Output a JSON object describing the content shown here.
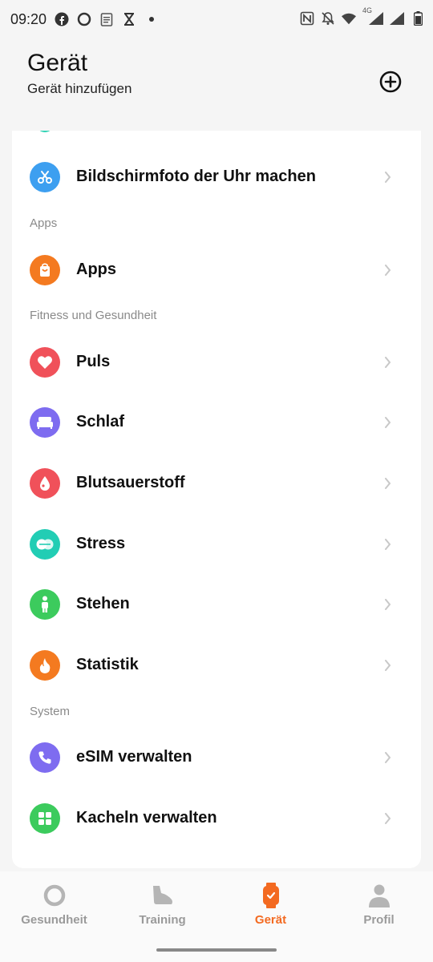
{
  "status_bar": {
    "time": "09:20",
    "left_icons": [
      "facebook-icon",
      "circle-app-icon",
      "clipboard-icon",
      "hourglass-icon",
      "dot-icon"
    ],
    "right_icons": [
      "nfc-icon",
      "bell-off-icon",
      "wifi-icon",
      "signal-4g-icon",
      "signal-icon",
      "battery-icon"
    ],
    "network_label": "4G"
  },
  "header": {
    "title": "Gerät",
    "subtitle": "Gerät hinzufügen"
  },
  "list": {
    "screenshot_item": {
      "label": "Bildschirmfoto der Uhr machen",
      "icon": "screenshot-icon",
      "color": "#3d9ff0"
    },
    "section_apps": "Apps",
    "apps_item": {
      "label": "Apps",
      "icon": "shopping-bag-icon",
      "color": "#f47a20"
    },
    "section_fitness": "Fitness und Gesundheit",
    "fitness_items": [
      {
        "label": "Puls",
        "icon": "heart-icon",
        "color": "#f0515a"
      },
      {
        "label": "Schlaf",
        "icon": "bed-icon",
        "color": "#7e6cf0"
      },
      {
        "label": "Blutsauerstoff",
        "icon": "blood-drop-icon",
        "color": "#f0515a"
      },
      {
        "label": "Stress",
        "icon": "stress-icon",
        "color": "#22cdb4"
      },
      {
        "label": "Stehen",
        "icon": "standing-person-icon",
        "color": "#3ccb5d"
      },
      {
        "label": "Statistik",
        "icon": "flame-icon",
        "color": "#f47a20"
      }
    ],
    "section_system": "System",
    "system_items": [
      {
        "label": "eSIM verwalten",
        "icon": "phone-icon",
        "color": "#7e6cf0"
      },
      {
        "label": "Kacheln verwalten",
        "icon": "tiles-icon",
        "color": "#3ccb5d"
      }
    ]
  },
  "bottom_nav": {
    "items": [
      {
        "label": "Gesundheit",
        "icon": "health-ring-icon",
        "active": false
      },
      {
        "label": "Training",
        "icon": "shoe-icon",
        "active": false
      },
      {
        "label": "Gerät",
        "icon": "watch-icon",
        "active": true
      },
      {
        "label": "Profil",
        "icon": "person-icon",
        "active": false
      }
    ],
    "active_color": "#f36a21"
  }
}
